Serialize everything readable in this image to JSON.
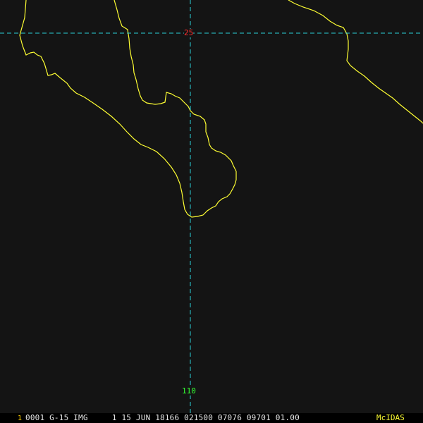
{
  "colors": {
    "background": "#141414",
    "coastline": "#ffff33",
    "gridline": "#2ad0d8",
    "lat_label": "#ff3030",
    "lon_label": "#33ff33",
    "status_text": "#e8e8e8",
    "frame_number": "#ffd000",
    "mcidas": "#ffff33"
  },
  "grid": {
    "latitude_label": "25",
    "longitude_label": "110"
  },
  "status_bar": {
    "frame_number": "1",
    "text": "0001 G-15 IMG     1 15 JUN 18166 021500 07076 09701 01.00",
    "mcidas_label": "McIDAS"
  }
}
